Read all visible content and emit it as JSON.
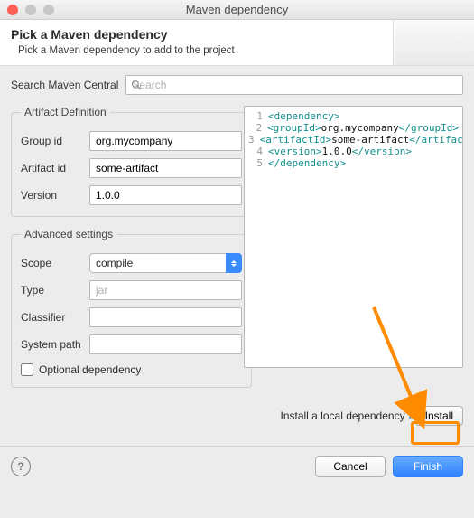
{
  "window": {
    "title": "Maven dependency"
  },
  "header": {
    "title": "Pick a Maven dependency",
    "subtitle": "Pick a Maven dependency to add to the project"
  },
  "search": {
    "label": "Search Maven Central",
    "placeholder": "Search"
  },
  "artifact": {
    "legend": "Artifact Definition",
    "groupId": {
      "label": "Group id",
      "value": "org.mycompany"
    },
    "artifactId": {
      "label": "Artifact id",
      "value": "some-artifact"
    },
    "version": {
      "label": "Version",
      "value": "1.0.0"
    }
  },
  "advanced": {
    "legend": "Advanced settings",
    "scope": {
      "label": "Scope",
      "value": "compile"
    },
    "type": {
      "label": "Type",
      "placeholder": "jar",
      "value": ""
    },
    "classifier": {
      "label": "Classifier",
      "value": ""
    },
    "systemPath": {
      "label": "System path",
      "value": ""
    },
    "optional": {
      "label": "Optional dependency",
      "checked": false
    }
  },
  "xml": {
    "lines": {
      "l1": {
        "n": "1",
        "a": "<dependency>",
        "b": "",
        "c": ""
      },
      "l2": {
        "n": "2",
        "a": "    <groupId>",
        "b": "org.mycompany",
        "c": "</groupId>"
      },
      "l3": {
        "n": "3",
        "a": "    <artifactId>",
        "b": "some-artifact",
        "c": "</artifactId>"
      },
      "l4": {
        "n": "4",
        "a": "    <version>",
        "b": "1.0.0",
        "c": "</version>"
      },
      "l5": {
        "n": "5",
        "a": "</dependency>",
        "b": "",
        "c": ""
      }
    }
  },
  "install": {
    "text": "Install a local dependency",
    "button": "Install"
  },
  "footer": {
    "cancel": "Cancel",
    "finish": "Finish"
  }
}
